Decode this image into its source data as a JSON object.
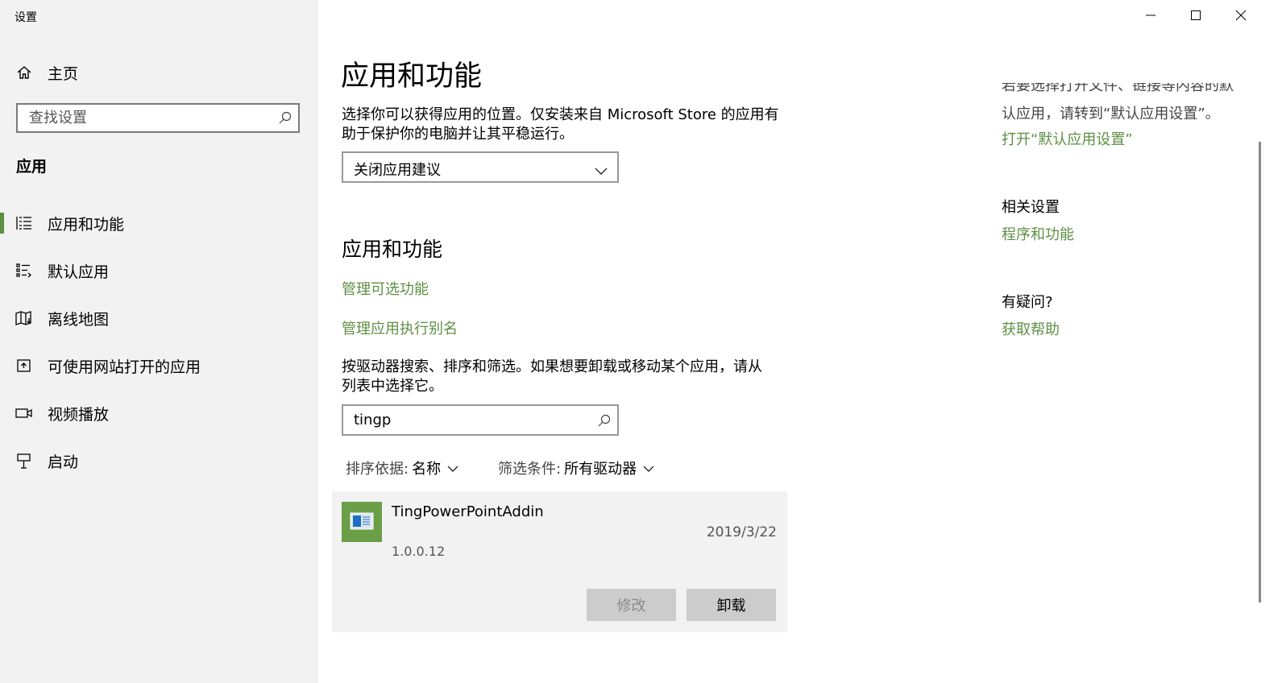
{
  "window": {
    "title": "设置",
    "controls": {
      "minimize": "minimize-icon",
      "maximize": "maximize-icon",
      "close": "close-icon"
    }
  },
  "sidebar": {
    "home_label": "主页",
    "search_placeholder": "查找设置",
    "section_header": "应用",
    "items": [
      {
        "label": "应用和功能",
        "icon": "apps-features-icon",
        "active": true
      },
      {
        "label": "默认应用",
        "icon": "default-apps-icon",
        "active": false
      },
      {
        "label": "离线地图",
        "icon": "offline-maps-icon",
        "active": false
      },
      {
        "label": "可使用网站打开的应用",
        "icon": "apps-for-websites-icon",
        "active": false
      },
      {
        "label": "视频播放",
        "icon": "video-playback-icon",
        "active": false
      },
      {
        "label": "启动",
        "icon": "startup-icon",
        "active": false
      }
    ]
  },
  "main": {
    "title": "应用和功能",
    "install_desc_line1": "选择你可以获得应用的位置。仅安装来自 Microsoft Store 的应用有",
    "install_desc_line2": "助于保护你的电脑并让其平稳运行。",
    "install_source_value": "关闭应用建议",
    "subtitle": "应用和功能",
    "link_optional_features": "管理可选功能",
    "link_exec_alias": "管理应用执行别名",
    "search_desc_line1": "按驱动器搜索、排序和筛选。如果想要卸载或移动某个应用，请从",
    "search_desc_line2": "列表中选择它。",
    "app_search_value": "tingp",
    "sort_label": "排序依据:",
    "sort_value": "名称",
    "filter_label": "筛选条件:",
    "filter_value": "所有驱动器",
    "apps": [
      {
        "name": "TingPowerPointAddin",
        "date": "2019/3/22",
        "version": "1.0.0.12",
        "modify_label": "修改",
        "uninstall_label": "卸载"
      }
    ]
  },
  "right": {
    "clipped_top_text": "若要选择打开文件、链接等内容的默",
    "clipped_line2": "认应用，请转到“默认应用设置”。",
    "link_default_settings": "打开“默认应用设置”",
    "related_header": "相关设置",
    "link_programs": "程序和功能",
    "question_header": "有疑问?",
    "link_help": "获取帮助"
  },
  "colors": {
    "accent": "#5e8f43",
    "sidebar_bg": "#f2f2f2",
    "card_bg": "#f2f2f2",
    "button_bg": "#cccccc"
  }
}
